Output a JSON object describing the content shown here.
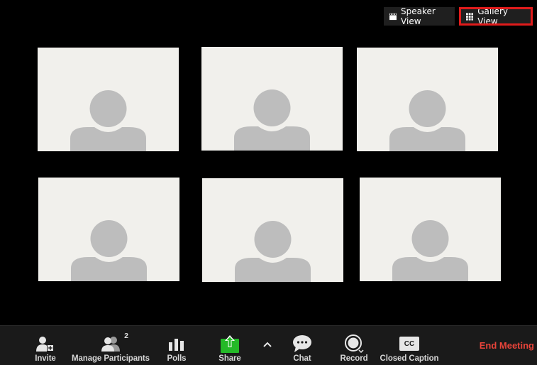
{
  "view_switch": {
    "speaker_label": "Speaker View",
    "gallery_label": "Gallery View",
    "active": "gallery",
    "highlight_color": "#e01b1b"
  },
  "tiles": [
    {
      "avatar": "default-user"
    },
    {
      "avatar": "default-user"
    },
    {
      "avatar": "default-user"
    },
    {
      "avatar": "default-user"
    },
    {
      "avatar": "default-user"
    },
    {
      "avatar": "default-user"
    }
  ],
  "toolbar": {
    "invite_label": "Invite",
    "participants_label": "Manage Participants",
    "participants_count": "2",
    "polls_label": "Polls",
    "share_label": "Share",
    "chat_label": "Chat",
    "record_label": "Record",
    "cc_label": "Closed Caption",
    "cc_icon_text": "CC",
    "end_label": "End Meeting",
    "share_color": "#24b928",
    "end_color": "#e8443a"
  }
}
